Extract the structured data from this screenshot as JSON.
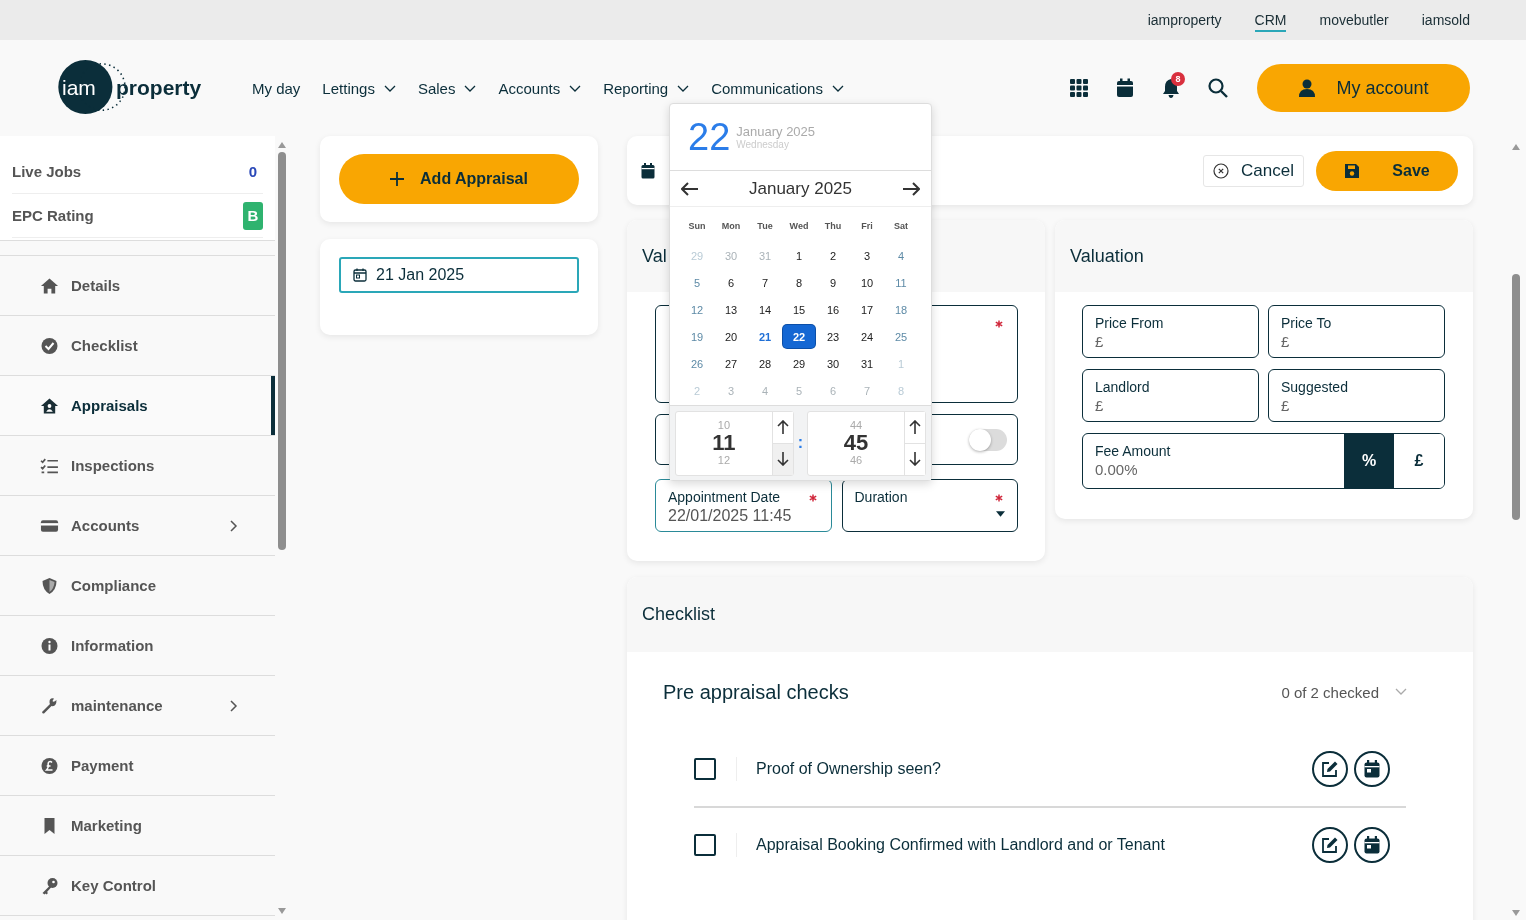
{
  "top_links": [
    {
      "label": "iamproperty",
      "selected": false
    },
    {
      "label": "CRM",
      "selected": true
    },
    {
      "label": "movebutler",
      "selected": false
    },
    {
      "label": "iamsold",
      "selected": false
    }
  ],
  "logo": {
    "mark": "iam",
    "word": "property"
  },
  "nav": [
    {
      "label": "My day",
      "dropdown": false
    },
    {
      "label": "Lettings",
      "dropdown": true
    },
    {
      "label": "Sales",
      "dropdown": true
    },
    {
      "label": "Accounts",
      "dropdown": true
    },
    {
      "label": "Reporting",
      "dropdown": true
    },
    {
      "label": "Communications",
      "dropdown": true
    }
  ],
  "notification_badge": "8",
  "account_button": "My account",
  "sidebar": {
    "stats": [
      {
        "label": "Live Jobs",
        "value": "0",
        "kind": "count"
      },
      {
        "label": "EPC Rating",
        "value": "B",
        "kind": "badge",
        "color": "#2fb36f"
      }
    ],
    "items": [
      {
        "label": "Details",
        "kind": "home",
        "selected": false,
        "submenu": false
      },
      {
        "label": "Checklist",
        "kind": "check",
        "selected": false,
        "submenu": false
      },
      {
        "label": "Appraisals",
        "kind": "house-user",
        "selected": true,
        "submenu": false
      },
      {
        "label": "Inspections",
        "kind": "list",
        "selected": false,
        "submenu": false
      },
      {
        "label": "Accounts",
        "kind": "card",
        "selected": false,
        "submenu": true
      },
      {
        "label": "Compliance",
        "kind": "shield",
        "selected": false,
        "submenu": false
      },
      {
        "label": "Information",
        "kind": "info",
        "selected": false,
        "submenu": false
      },
      {
        "label": "maintenance",
        "kind": "wrench",
        "selected": false,
        "submenu": true
      },
      {
        "label": "Payment",
        "kind": "pound",
        "selected": false,
        "submenu": false
      },
      {
        "label": "Marketing",
        "kind": "bookmark",
        "selected": false,
        "submenu": false
      },
      {
        "label": "Key Control",
        "kind": "key",
        "selected": false,
        "submenu": false
      }
    ]
  },
  "add_button": "Add Appraisal",
  "date_filter": {
    "value": "21 Jan 2025"
  },
  "toolbar": {
    "cancel": "Cancel",
    "save": "Save"
  },
  "appointment_card": {
    "title": "Val",
    "fields": [
      {
        "kind": "textarea",
        "required": true
      },
      {
        "kind": "toggle",
        "on": false
      },
      {
        "kind": "date",
        "label": "Appointment Date",
        "value": "22/01/2025 11:45",
        "required": true
      },
      {
        "kind": "select",
        "label": "Duration",
        "required": true
      }
    ]
  },
  "valuation": {
    "title": "Valuation",
    "fields": [
      {
        "label": "Price From",
        "prefix": "£"
      },
      {
        "label": "Price To",
        "prefix": "£"
      },
      {
        "label": "Landlord",
        "prefix": "£"
      },
      {
        "label": "Suggested",
        "prefix": "£"
      }
    ],
    "fee": {
      "label": "Fee Amount",
      "placeholder": "0.00%",
      "units": [
        {
          "label": "%",
          "selected": true
        },
        {
          "label": "£",
          "selected": false
        }
      ]
    }
  },
  "checklist": {
    "title": "Checklist",
    "sections": [
      {
        "title": "Pre appraisal checks",
        "count": "0 of 2 checked",
        "items": [
          {
            "label": "Proof of Ownership seen?",
            "checked": false
          },
          {
            "label": "Appraisal Booking Confirmed with Landlord and or Tenant",
            "checked": false
          }
        ]
      }
    ]
  },
  "date_picker": {
    "day": "22",
    "month_year": "January 2025",
    "weekday": "Wednesday",
    "title": "January 2025",
    "weekdays": [
      "Sun",
      "Mon",
      "Tue",
      "Wed",
      "Thu",
      "Fri",
      "Sat"
    ],
    "weeks": [
      [
        {
          "d": "29",
          "outside": true,
          "today": false,
          "selected": false
        },
        {
          "d": "30",
          "outside": true,
          "today": false,
          "selected": false
        },
        {
          "d": "31",
          "outside": true,
          "today": false,
          "selected": false
        },
        {
          "d": "1",
          "outside": false,
          "today": false,
          "selected": false
        },
        {
          "d": "2",
          "outside": false,
          "today": false,
          "selected": false
        },
        {
          "d": "3",
          "outside": false,
          "today": false,
          "selected": false
        },
        {
          "d": "4",
          "outside": false,
          "today": false,
          "selected": false
        }
      ],
      [
        {
          "d": "5",
          "outside": false,
          "today": false,
          "selected": false
        },
        {
          "d": "6",
          "outside": false,
          "today": false,
          "selected": false
        },
        {
          "d": "7",
          "outside": false,
          "today": false,
          "selected": false
        },
        {
          "d": "8",
          "outside": false,
          "today": false,
          "selected": false
        },
        {
          "d": "9",
          "outside": false,
          "today": false,
          "selected": false
        },
        {
          "d": "10",
          "outside": false,
          "today": false,
          "selected": false
        },
        {
          "d": "11",
          "outside": false,
          "today": false,
          "selected": false
        }
      ],
      [
        {
          "d": "12",
          "outside": false,
          "today": false,
          "selected": false
        },
        {
          "d": "13",
          "outside": false,
          "today": false,
          "selected": false
        },
        {
          "d": "14",
          "outside": false,
          "today": false,
          "selected": false
        },
        {
          "d": "15",
          "outside": false,
          "today": false,
          "selected": false
        },
        {
          "d": "16",
          "outside": false,
          "today": false,
          "selected": false
        },
        {
          "d": "17",
          "outside": false,
          "today": false,
          "selected": false
        },
        {
          "d": "18",
          "outside": false,
          "today": false,
          "selected": false
        }
      ],
      [
        {
          "d": "19",
          "outside": false,
          "today": false,
          "selected": false
        },
        {
          "d": "20",
          "outside": false,
          "today": false,
          "selected": false
        },
        {
          "d": "21",
          "outside": false,
          "today": true,
          "selected": false
        },
        {
          "d": "22",
          "outside": false,
          "today": false,
          "selected": true
        },
        {
          "d": "23",
          "outside": false,
          "today": false,
          "selected": false
        },
        {
          "d": "24",
          "outside": false,
          "today": false,
          "selected": false
        },
        {
          "d": "25",
          "outside": false,
          "today": false,
          "selected": false
        }
      ],
      [
        {
          "d": "26",
          "outside": false,
          "today": false,
          "selected": false
        },
        {
          "d": "27",
          "outside": false,
          "today": false,
          "selected": false
        },
        {
          "d": "28",
          "outside": false,
          "today": false,
          "selected": false
        },
        {
          "d": "29",
          "outside": false,
          "today": false,
          "selected": false
        },
        {
          "d": "30",
          "outside": false,
          "today": false,
          "selected": false
        },
        {
          "d": "31",
          "outside": false,
          "today": false,
          "selected": false
        },
        {
          "d": "1",
          "outside": true,
          "today": false,
          "selected": false
        }
      ],
      [
        {
          "d": "2",
          "outside": true,
          "today": false,
          "selected": false
        },
        {
          "d": "3",
          "outside": true,
          "today": false,
          "selected": false
        },
        {
          "d": "4",
          "outside": true,
          "today": false,
          "selected": false
        },
        {
          "d": "5",
          "outside": true,
          "today": false,
          "selected": false
        },
        {
          "d": "6",
          "outside": true,
          "today": false,
          "selected": false
        },
        {
          "d": "7",
          "outside": true,
          "today": false,
          "selected": false
        },
        {
          "d": "8",
          "outside": true,
          "today": false,
          "selected": false
        }
      ]
    ],
    "time": {
      "hour": {
        "prev": "10",
        "value": "11",
        "next": "12"
      },
      "separator": ":",
      "minute": {
        "prev": "44",
        "value": "45",
        "next": "46"
      }
    }
  }
}
